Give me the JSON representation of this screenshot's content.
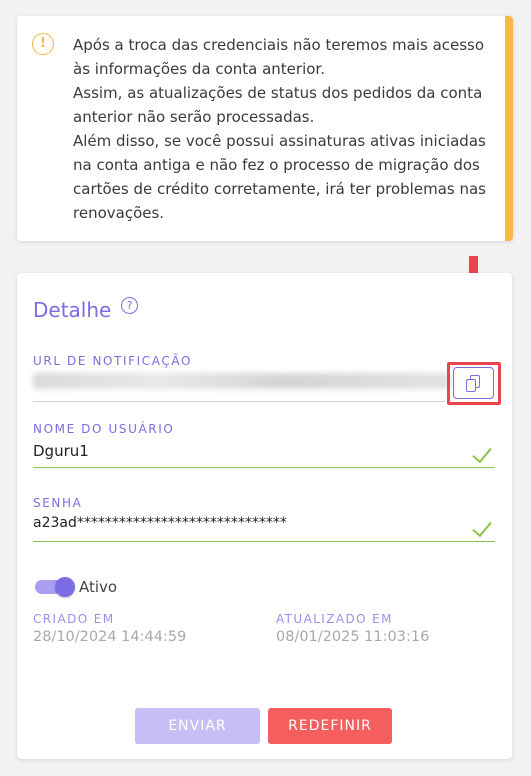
{
  "alert": {
    "icon": "warning-circle-icon",
    "accent_color": "#f5b94a",
    "paragraphs": [
      "Após a troca das credenciais não teremos mais acesso às informações da conta anterior.",
      "Assim, as atualizações de status dos pedidos da conta anterior não serão processadas.",
      "Além disso, se você possui assinaturas ativas iniciadas na conta antiga e não fez o processo de migração dos cartões de crédito corretamente, irá ter problemas nas renovações."
    ]
  },
  "detail": {
    "title": "Detalhe",
    "help_icon": "question-circle-icon",
    "url_label": "URL DE NOTIFICAÇÃO",
    "copy_icon": "copy-icon",
    "username_label": "NOME DO USUÁRIO",
    "username_value": "Dguru1",
    "password_label": "SENHA",
    "password_value": "a23ad******************************",
    "active_label": "Ativo",
    "active": true,
    "created_label": "CRIADO EM",
    "created_value": "28/10/2024 14:44:59",
    "updated_label": "ATUALIZADO EM",
    "updated_value": "08/01/2025 11:03:16",
    "send_button": "ENVIAR",
    "reset_button": "REDEFINIR"
  },
  "colors": {
    "primary": "#7b6ce6",
    "valid": "#8bc34a",
    "danger": "#f55e5e",
    "annotation": "#e8454f"
  }
}
